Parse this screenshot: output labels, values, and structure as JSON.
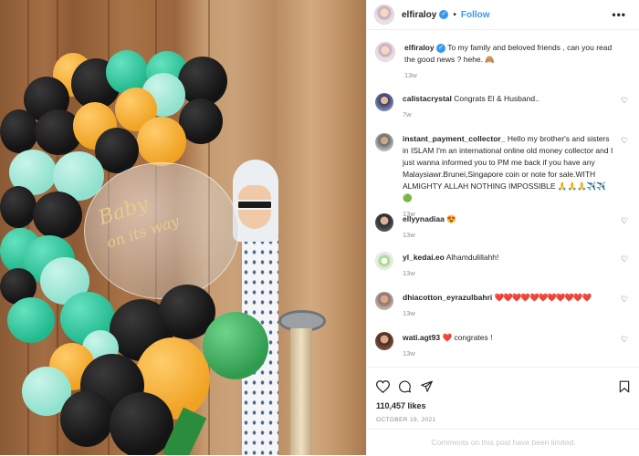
{
  "header": {
    "username": "elfiraloy",
    "verified_icon": "verified-badge-icon",
    "separator": "•",
    "follow_label": "Follow",
    "more_label": "•••"
  },
  "caption": {
    "username": "elfiraloy",
    "text": "To my family and beloved friends , can you read the good news ? hehe. 🙈",
    "time": "13w"
  },
  "comments": [
    {
      "username": "calistacrystal",
      "text": "Congrats El & Husband..",
      "time": "7w"
    },
    {
      "username": "instant_payment_collector_",
      "text": "Hello my brother's and sisters in ISLAM I'm an international online old money collector and I just wanna informed you to PM me back if you have any Malaysiawr.Brunei,Singapore coin or note for sale.WITH ALMIGHTY ALLAH NOTHING IMPOSSIBLE 🙏🙏🙏✈️✈️🟢",
      "time": "13w"
    },
    {
      "username": "ellyynadiaa",
      "text": "😍",
      "time": "13w"
    },
    {
      "username": "yl_kedai.eo",
      "text": "Alhamdulillahh!",
      "time": "13w"
    },
    {
      "username": "dhiacotton_eyrazulbahri",
      "text": "❤️❤️❤️❤️❤️❤️❤️❤️❤️❤️❤️",
      "time": "13w"
    },
    {
      "username": "wati.agt93",
      "text": "❤️ congrates !",
      "time": "13w"
    }
  ],
  "actions": {
    "like_icon": "heart-outline-icon",
    "comment_icon": "comment-bubble-icon",
    "share_icon": "share-paper-plane-icon",
    "save_icon": "bookmark-icon",
    "likes": "110,457 likes",
    "date": "OCTOBER 19, 2021"
  },
  "footer": {
    "limited_text": "Comments on this post have been limited."
  },
  "photo": {
    "balloon_text_line1": "Baby",
    "balloon_text_line2": "on its way"
  },
  "colors": {
    "link_blue": "#3897f0",
    "muted_gray": "#8e8e8e"
  }
}
